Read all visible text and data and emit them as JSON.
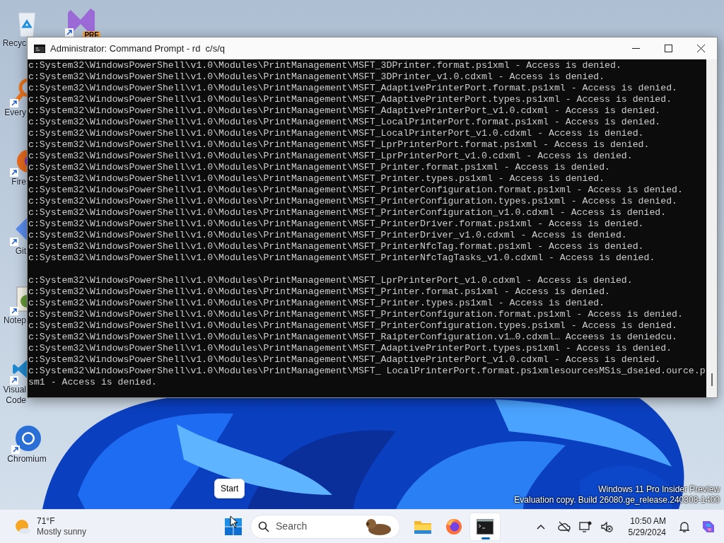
{
  "desktop_icons": [
    {
      "kind": "recycle_bin",
      "label": [
        "Recyc"
      ]
    },
    {
      "kind": "everything",
      "label": [
        "Every"
      ]
    },
    {
      "kind": "firefox",
      "label": [
        "Fire"
      ]
    },
    {
      "kind": "git",
      "label": [
        "Git"
      ]
    },
    {
      "kind": "notepad",
      "label": [
        "Notep"
      ]
    },
    {
      "kind": "vscode",
      "label": [
        "Visual",
        "Code"
      ]
    },
    {
      "kind": "chromium",
      "label": [
        "Chromium"
      ]
    }
  ],
  "desktop_icons_2": [
    {
      "kind": "vs_preview",
      "badge": "PRE"
    }
  ],
  "window": {
    "title": "Administrator: Command Prompt - rd  c/s/q",
    "console_blocks": [
      [
        "c:System32\\WindowsPowerShell\\v1.0\\Modules\\PrintManagement\\MSFT_3DPrinter.format.ps1xml - Access is denied.",
        "c:System32\\WindowsPowerShell\\v1.0\\Modules\\PrintManagement\\MSFT_3DPrinter_v1.0.cdxml - Access is denied.",
        "c:System32\\WindowsPowerShell\\v1.0\\Modules\\PrintManagement\\MSFT_AdaptivePrinterPort.format.ps1xml - Access is denied.",
        "c:System32\\WindowsPowerShell\\v1.0\\Modules\\PrintManagement\\MSFT_AdaptivePrinterPort.types.ps1xml - Access is denied.",
        "c:System32\\WindowsPowerShell\\v1.0\\Modules\\PrintManagement\\MSFT_AdaptivePrinterPort_v1.0.cdxml - Access is denied.",
        "c:System32\\WindowsPowerShell\\v1.0\\Modules\\PrintManagement\\MSFT_LocalPrinterPort.format.ps1xml - Access is denied.",
        "c:System32\\WindowsPowerShell\\v1.0\\Modules\\PrintManagement\\MSFT_LocalPrinterPort_v1.0.cdxml - Access is denied.",
        "c:System32\\WindowsPowerShell\\v1.0\\Modules\\PrintManagement\\MSFT_LprPrinterPort.format.ps1xml - Access is denied.",
        "c:System32\\WindowsPowerShell\\v1.0\\Modules\\PrintManagement\\MSFT_LprPrinterPort_v1.0.cdxml - Access is denied.",
        "c:System32\\WindowsPowerShell\\v1.0\\Modules\\PrintManagement\\MSFT_Printer.format.ps1xml - Access is denied.",
        "c:System32\\WindowsPowerShell\\v1.0\\Modules\\PrintManagement\\MSFT_Printer.types.ps1xml - Access is denied.",
        "c:System32\\WindowsPowerShell\\v1.0\\Modules\\PrintManagement\\MSFT_PrinterConfiguration.format.ps1xml - Access is denied.",
        "c:System32\\WindowsPowerShell\\v1.0\\Modules\\PrintManagement\\MSFT_PrinterConfiguration.types.ps1xml - Access is denied.",
        "c:System32\\WindowsPowerShell\\v1.0\\Modules\\PrintManagement\\MSFT_PrinterConfiguration_v1.0.cdxml - Access is denied.",
        "c:System32\\WindowsPowerShell\\v1.0\\Modules\\PrintManagement\\MSFT_PrinterDriver.format.ps1xml - Access is denied.",
        "c:System32\\WindowsPowerShell\\v1.0\\Modules\\PrintManagement\\MSFT_PrinterDriver_v1.0.cdxml - Access is denied.",
        "c:System32\\WindowsPowerShell\\v1.0\\Modules\\PrintManagement\\MSFT_PrinterNfcTag.format.ps1xml - Access is denied.",
        "c:System32\\WindowsPowerShell\\v1.0\\Modules\\PrintManagement\\MSFT_PrinterNfcTagTasks_v1.0.cdxml - Access is denied."
      ],
      [
        "c:System32\\WindowsPowerShell\\v1.0\\Modules\\PrintManagement\\MSFT_LprPrinterPort_v1.0.cdxml - Access is denied.",
        "c:System32\\WindowsPowerShell\\v1.0\\Modules\\PrintManagement\\MSFT_Printer.format.ps1xml - Access is denied.",
        "c:System32\\WindowsPowerShell\\v1.0\\Modules\\PrintManagement\\MSFT_Printer.types.ps1xml - Access is denied.",
        "c:System32\\WindowsPowerShell\\v1.0\\Modules\\PrintManagement\\MSFT_PrinterConfiguration.format.ps1xml - Access is denied.",
        "c:System32\\WindowsPowerShell\\v1.0\\Modules\\PrintManagement\\MSFT_PrinterConfiguration.types.ps1xml - Access is denied.",
        "c:System32\\WindowsPowerShell\\v1.0\\Modules\\PrintManagement\\MSFT_RaipterConfiguration.v1…0.cdxml… Acceess is deniedcu.",
        "c:System32\\WindowsPowerShell\\v1.0\\Modules\\PrintManagement\\MSFT_AdaptivePrinterPort.types.ps1xml - Access is denied.",
        "c:System32\\WindowsPowerShell\\v1.0\\Modules\\PrintManagement\\MSFT_AdaptivePrinterPort_v1.0.cdxml - Access is denied.",
        "c:System32\\WindowsPowerShell\\v1.0\\Modules\\PrintManagement\\MSFT_ LocalPrinterPort.format.ps1xmlesourcesMSis_dseied.ource.p",
        "sm1 - Access is denied."
      ]
    ]
  },
  "tooltip": "Start",
  "watermark": [
    "Windows 11 Pro Insider Preview",
    "Evaluation copy. Build 26080.ge_release.240308-1400"
  ],
  "taskbar": {
    "weather": {
      "temperature": "71°F",
      "condition": "Mostly sunny"
    },
    "search": {
      "placeholder": "Search"
    },
    "apps": [
      {
        "kind": "explorer",
        "selected": false
      },
      {
        "kind": "firefox",
        "selected": false
      },
      {
        "kind": "terminal",
        "selected": true
      }
    ],
    "clock": {
      "time": "10:50 AM",
      "date": "5/29/2024"
    }
  }
}
